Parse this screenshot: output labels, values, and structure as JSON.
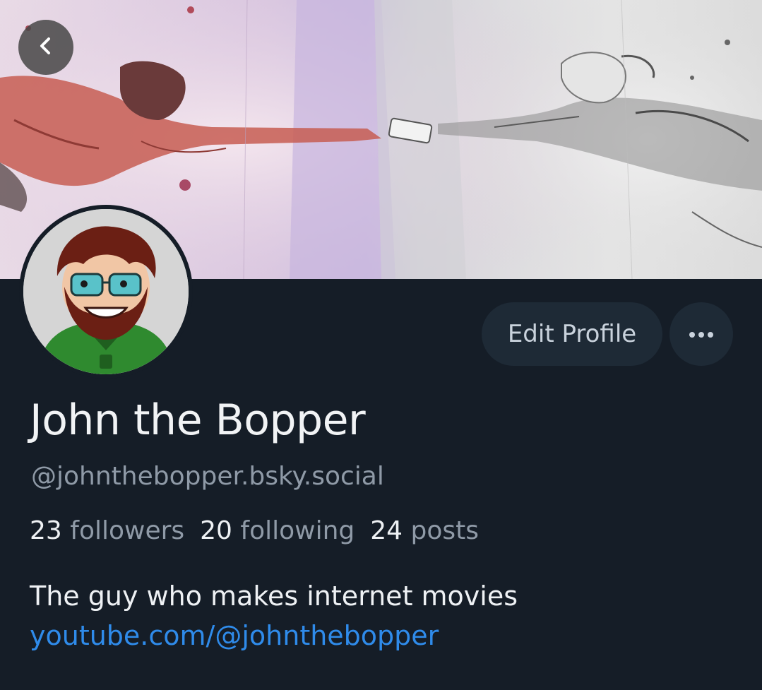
{
  "profile": {
    "display_name": "John the Bopper",
    "handle": "@johnthebopper.bsky.social",
    "bio": "The guy who makes internet movies",
    "link": "youtube.com/@johnthebopper"
  },
  "stats": {
    "followers_count": "23",
    "followers_label": "followers",
    "following_count": "20",
    "following_label": "following",
    "posts_count": "24",
    "posts_label": "posts"
  },
  "actions": {
    "edit_profile_label": "Edit Profile"
  },
  "icons": {
    "back": "chevron-left-icon",
    "more": "ellipsis-icon"
  },
  "colors": {
    "background": "#151d27",
    "button_bg": "#1e2a36",
    "primary_text": "#eef1f4",
    "secondary_text": "#8f9aa7",
    "link": "#2f8bea"
  }
}
